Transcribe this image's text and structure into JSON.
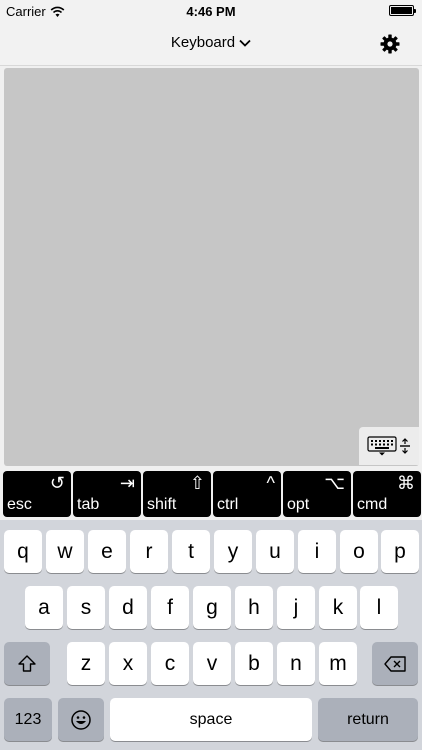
{
  "status_bar": {
    "carrier": "Carrier",
    "time": "4:46 PM"
  },
  "nav": {
    "title": "Keyboard"
  },
  "modifiers": [
    {
      "label": "esc",
      "symbol": "↺"
    },
    {
      "label": "tab",
      "symbol": "⇥"
    },
    {
      "label": "shift",
      "symbol": "⇧"
    },
    {
      "label": "ctrl",
      "symbol": "^"
    },
    {
      "label": "opt",
      "symbol": "⌥"
    },
    {
      "label": "cmd",
      "symbol": "⌘"
    }
  ],
  "keyboard": {
    "row1": [
      "q",
      "w",
      "e",
      "r",
      "t",
      "y",
      "u",
      "i",
      "o",
      "p"
    ],
    "row2": [
      "a",
      "s",
      "d",
      "f",
      "g",
      "h",
      "j",
      "k",
      "l"
    ],
    "row3": [
      "z",
      "x",
      "c",
      "v",
      "b",
      "n",
      "m"
    ],
    "numbers_label": "123",
    "space_label": "space",
    "return_label": "return"
  },
  "icons": [
    "wifi-icon",
    "battery-icon",
    "chevron-down-icon",
    "gear-icon",
    "keyboard-icon",
    "resize-icon",
    "shift-icon",
    "backspace-icon",
    "emoji-icon"
  ]
}
